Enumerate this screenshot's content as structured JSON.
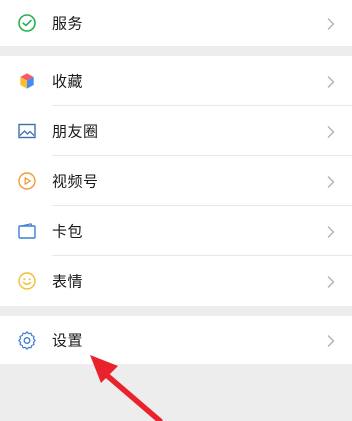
{
  "menu_group_1": {
    "items": [
      {
        "label": "服务",
        "icon": "wechat-pay-icon"
      }
    ]
  },
  "menu_group_2": {
    "items": [
      {
        "label": "收藏",
        "icon": "favorites-cube-icon"
      },
      {
        "label": "朋友圈",
        "icon": "moments-image-icon"
      },
      {
        "label": "视频号",
        "icon": "channels-play-icon"
      },
      {
        "label": "卡包",
        "icon": "card-wallet-icon"
      },
      {
        "label": "表情",
        "icon": "sticker-smiley-icon"
      }
    ]
  },
  "menu_group_3": {
    "items": [
      {
        "label": "设置",
        "icon": "settings-gear-icon"
      }
    ]
  },
  "colors": {
    "background": "#ededed",
    "panel": "#ffffff",
    "text": "#191919",
    "chevron": "#b2b2b2",
    "annotation_arrow": "#e8232b"
  }
}
